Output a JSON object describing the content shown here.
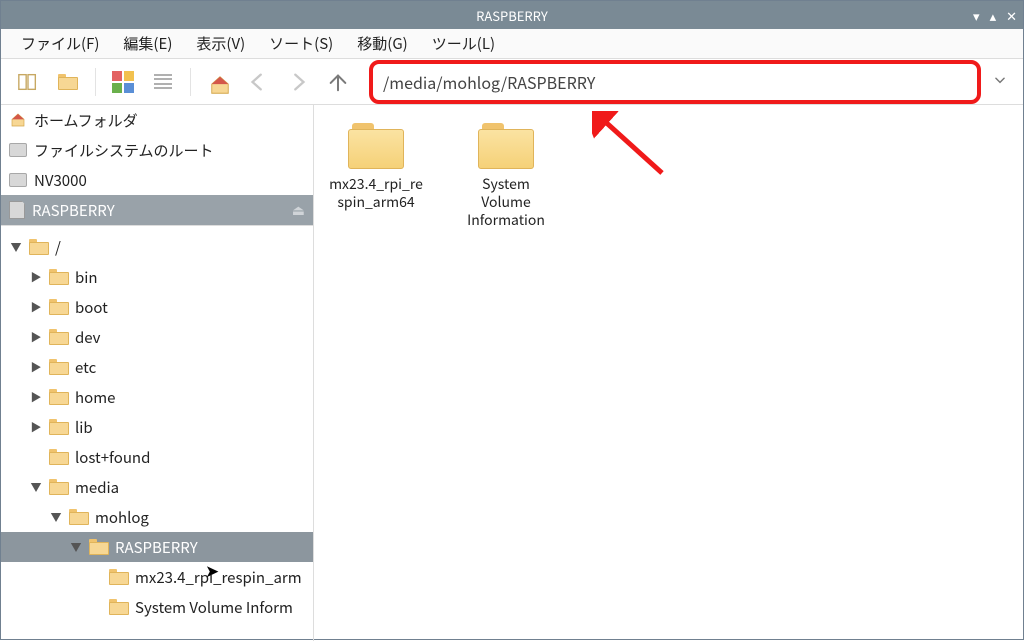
{
  "window": {
    "title": "RASPBERRY",
    "controls": {
      "min": "▾",
      "max": "▴",
      "close": "✕"
    }
  },
  "menu": {
    "file": "ファイル(F)",
    "edit": "編集(E)",
    "view": "表示(V)",
    "sort": "ソート(S)",
    "go": "移動(G)",
    "tools": "ツール(L)"
  },
  "toolbar": {
    "path": "/media/mohlog/RASPBERRY"
  },
  "places": {
    "home": "ホームフォルダ",
    "root": "ファイルシステムのルート",
    "drive": "NV3000",
    "sd": "RASPBERRY"
  },
  "tree": {
    "root": "/",
    "bin": "bin",
    "boot": "boot",
    "dev": "dev",
    "etc": "etc",
    "home": "home",
    "lib": "lib",
    "lostfound": "lost+found",
    "media": "media",
    "mohlog": "mohlog",
    "raspberry": "RASPBERRY",
    "fA": "mx23.4_rpi_respin_arm",
    "fB": "System Volume Inform"
  },
  "files": {
    "0": {
      "label": "mx23.4_rpi_respin_arm64"
    },
    "1": {
      "label": "System Volume Information"
    }
  }
}
